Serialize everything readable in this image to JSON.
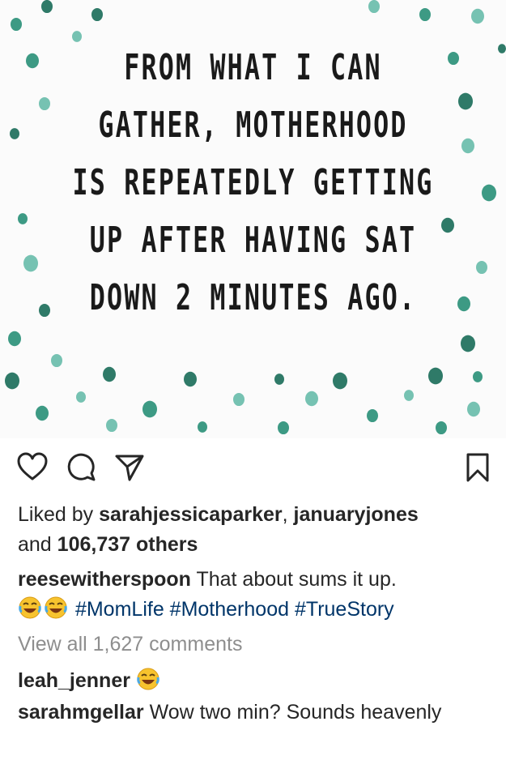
{
  "image": {
    "quote_lines": [
      "FROM WHAT I CAN",
      "GATHER, MOTHERHOOD",
      "IS REPEATEDLY GETTING",
      "UP AFTER HAVING SAT",
      "DOWN 2 MINUTES AGO."
    ],
    "dot_colors": [
      "#3d9a84",
      "#76c2b2",
      "#2f7a68"
    ]
  },
  "actions": {
    "like_icon": "heart-icon",
    "comment_icon": "comment-icon",
    "share_icon": "paper-plane-icon",
    "save_icon": "bookmark-icon"
  },
  "likes": {
    "prefix": "Liked by ",
    "user1": "sarahjessicaparker",
    "separator": ", ",
    "user2": "januaryjones",
    "and": "and ",
    "count": "106,737 others"
  },
  "caption": {
    "username": "reesewitherspoon",
    "text": " That about sums it up.",
    "emoji": "face-with-tears-of-joy",
    "hashtags": [
      "#MomLife",
      "#Motherhood",
      "#TrueStory"
    ]
  },
  "view_comments": "View all 1,627 comments",
  "comments": [
    {
      "username": "leah_jenner",
      "text": "",
      "emoji": "face-with-tears-of-joy"
    },
    {
      "username": "sarahmgellar",
      "text": " Wow two min? Sounds heavenly"
    }
  ]
}
